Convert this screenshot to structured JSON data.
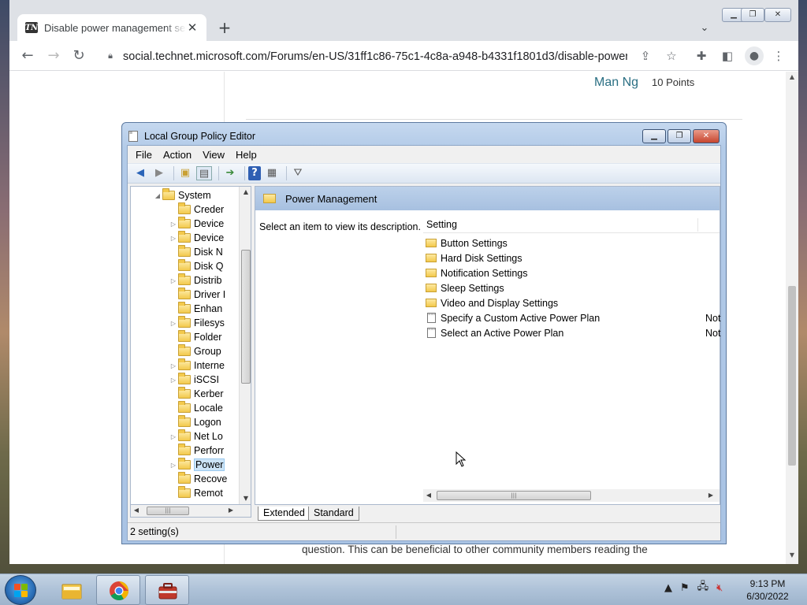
{
  "browser": {
    "tab_title": "Disable power management sett",
    "favicon_text": "TN",
    "url": "social.technet.microsoft.com/Forums/en-US/31ff1c86-75c1-4c8a-a948-b4331f1801d3/disable-power-..."
  },
  "page": {
    "author_name": "Man Ng",
    "author_points": "10 Points",
    "bottom_text": "question. This can be beneficial to other community members reading the"
  },
  "gpe": {
    "title": "Local Group Policy Editor",
    "menu": [
      "File",
      "Action",
      "Help",
      "View"
    ],
    "menu_order": [
      "File",
      "Action",
      "View",
      "Help"
    ],
    "tree": [
      {
        "label": "System",
        "expander": "open"
      },
      {
        "label": "Creder",
        "expander": "none"
      },
      {
        "label": "Device",
        "expander": "closed"
      },
      {
        "label": "Device",
        "expander": "closed"
      },
      {
        "label": "Disk N",
        "expander": "none"
      },
      {
        "label": "Disk Q",
        "expander": "none"
      },
      {
        "label": "Distrib",
        "expander": "closed"
      },
      {
        "label": "Driver I",
        "expander": "none"
      },
      {
        "label": "Enhan",
        "expander": "none"
      },
      {
        "label": "Filesys",
        "expander": "closed"
      },
      {
        "label": "Folder",
        "expander": "none"
      },
      {
        "label": "Group",
        "expander": "none"
      },
      {
        "label": "Interne",
        "expander": "closed"
      },
      {
        "label": "iSCSI",
        "expander": "closed"
      },
      {
        "label": "Kerber",
        "expander": "none"
      },
      {
        "label": "Locale",
        "expander": "none"
      },
      {
        "label": "Logon",
        "expander": "none"
      },
      {
        "label": "Net Lo",
        "expander": "closed"
      },
      {
        "label": "Perforr",
        "expander": "none"
      },
      {
        "label": "Power",
        "expander": "closed",
        "selected": true
      },
      {
        "label": "Recove",
        "expander": "none"
      },
      {
        "label": "Remot",
        "expander": "none"
      }
    ],
    "pane_header": "Power Management",
    "description": "Select an item to view its description.",
    "column_setting": "Setting",
    "settings": [
      {
        "name": "Button Settings",
        "type": "folder",
        "state": ""
      },
      {
        "name": "Hard Disk Settings",
        "type": "folder",
        "state": ""
      },
      {
        "name": "Notification Settings",
        "type": "folder",
        "state": ""
      },
      {
        "name": "Sleep Settings",
        "type": "folder",
        "state": ""
      },
      {
        "name": "Video and Display Settings",
        "type": "folder",
        "state": ""
      },
      {
        "name": "Specify a Custom Active Power Plan",
        "type": "policy",
        "state": "Not"
      },
      {
        "name": "Select an Active Power Plan",
        "type": "policy",
        "state": "Not"
      }
    ],
    "tab_extended": "Extended",
    "tab_standard": "Standard",
    "status": "2 setting(s)"
  },
  "taskbar": {
    "time": "9:13 PM",
    "date": "6/30/2022"
  },
  "colors": {
    "link_teal": "#2a6f83",
    "selection": "#cce4f7",
    "header_blue": "#a7c0e0"
  }
}
